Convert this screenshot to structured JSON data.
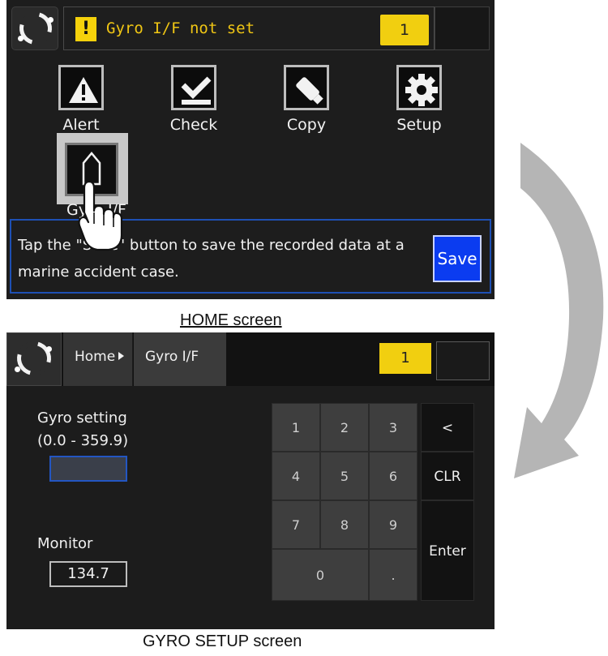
{
  "home": {
    "alert_text": "Gyro I/F not set",
    "alert_count": "1",
    "menu": [
      {
        "label": "Alert",
        "icon": "alert-icon"
      },
      {
        "label": "Check",
        "icon": "check-icon"
      },
      {
        "label": "Copy",
        "icon": "usb-icon"
      },
      {
        "label": "Setup",
        "icon": "gear-icon"
      }
    ],
    "gyro_button_label": "Gyro I/F",
    "info_text": "Tap the \"Save\" button to save the recorded data at a marine accident case.",
    "save_label": "Save",
    "caption": "HOME screen"
  },
  "gyro": {
    "breadcrumb_home": "Home",
    "breadcrumb_current": "Gyro I/F",
    "alert_count": "1",
    "setting_label_line1": "Gyro setting",
    "setting_label_line2": "(0.0 - 359.9)",
    "setting_value": "",
    "monitor_label": "Monitor",
    "monitor_value": "134.7",
    "keys": {
      "k1": "1",
      "k2": "2",
      "k3": "3",
      "back": "<",
      "k4": "4",
      "k5": "5",
      "k6": "6",
      "clr": "CLR",
      "k7": "7",
      "k8": "8",
      "k9": "9",
      "enter": "Enter",
      "k0": "0",
      "dot": "."
    },
    "caption": "GYRO SETUP screen"
  },
  "colors": {
    "alert_yellow": "#f1cf10",
    "save_blue": "#0b3cf0",
    "flow_arrow": "#b5b5b5"
  }
}
